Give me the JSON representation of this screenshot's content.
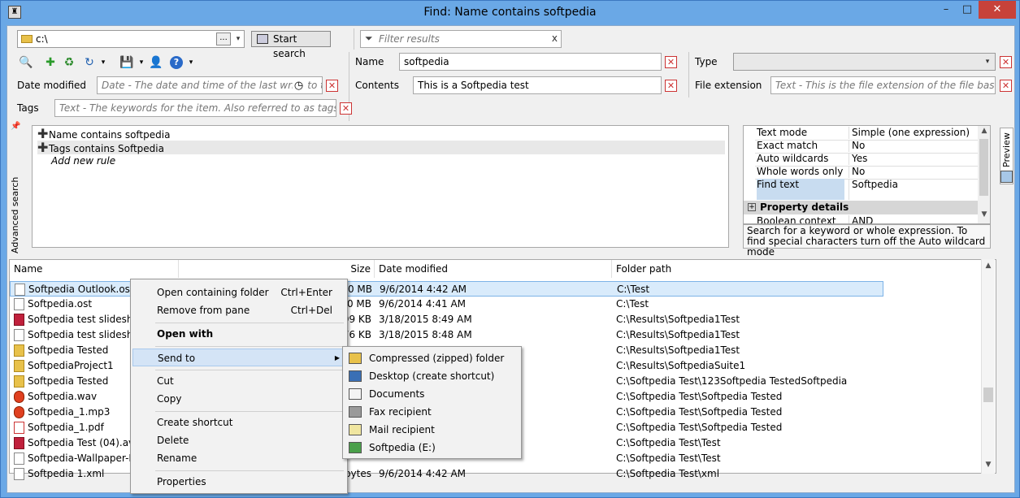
{
  "window": {
    "title": "Find: Name contains softpedia",
    "app_icon_glyph": "♜",
    "minimize_glyph": "–",
    "maximize_glyph": "□",
    "close_glyph": "✕"
  },
  "topbar": {
    "path_value": "c:\\",
    "browse_label": "...",
    "start_search_label": "Start search",
    "filter_placeholder": "Filter results",
    "filter_clear": "x"
  },
  "criteria": {
    "name_label": "Name",
    "name_value": "softpedia",
    "type_label": "Type",
    "type_value": "",
    "date_label": "Date modified",
    "date_placeholder": "Date - The date and time of the last write to the",
    "contents_label": "Contents",
    "contents_value": "This is a Softpedia test",
    "ext_label": "File extension",
    "ext_placeholder": "Text - This is the file extension of the file based item,",
    "tags_label": "Tags",
    "tags_placeholder": "Text - The keywords for the item. Also referred to as tags",
    "clear_glyph": "✕"
  },
  "advanced": {
    "sidebar_label": "Advanced search",
    "rules": [
      "Name contains softpedia",
      "Tags contains Softpedia"
    ],
    "add_rule": "Add new rule"
  },
  "properties": {
    "rows": [
      {
        "k": "Text mode",
        "v": "Simple (one expression)"
      },
      {
        "k": "Exact match",
        "v": "No"
      },
      {
        "k": "Auto wildcards",
        "v": "Yes"
      },
      {
        "k": "Whole words only",
        "v": "No"
      },
      {
        "k": "Find text",
        "v": "Softpedia"
      }
    ],
    "category": "Property details",
    "category_toggle": "+",
    "partial_row_k": "Boolean context",
    "partial_row_v": "AND",
    "description": "Search for a keyword or whole expression. To find special characters turn off the Auto wildcard mode"
  },
  "preview_tab": "Preview",
  "results": {
    "columns": {
      "name": "Name",
      "size": "Size",
      "date": "Date modified",
      "folder": "Folder path"
    },
    "rows": [
      {
        "name": "Softpedia Outlook.ost",
        "size": "0 MB",
        "date": "9/6/2014 4:42 AM",
        "folder": "C:\\Test",
        "icon": "file"
      },
      {
        "name": "Softpedia.ost",
        "size": "0 MB",
        "date": "9/6/2014 4:41 AM",
        "folder": "C:\\Test",
        "icon": "file"
      },
      {
        "name": "Softpedia test slideshow",
        "size": "99 KB",
        "date": "3/18/2015 8:49 AM",
        "folder": "C:\\Results\\Softpedia1Test",
        "icon": "red"
      },
      {
        "name": "Softpedia test slideshow",
        "size": "76 KB",
        "date": "3/18/2015 8:48 AM",
        "folder": "C:\\Results\\Softpedia1Test",
        "icon": "file"
      },
      {
        "name": "Softpedia Tested",
        "size": "",
        "date": "",
        "folder": "C:\\Results\\Softpedia1Test",
        "icon": "folder"
      },
      {
        "name": "SoftpediaProject1",
        "size": "",
        "date": "",
        "folder": "C:\\Results\\SoftpediaSuite1",
        "icon": "folder"
      },
      {
        "name": "Softpedia Tested",
        "size": "",
        "date": "",
        "folder": "C:\\Softpedia Test\\123Softpedia TestedSoftpedia",
        "icon": "folder"
      },
      {
        "name": "Softpedia.wav",
        "size": "",
        "date": "",
        "folder": "C:\\Softpedia Test\\Softpedia Tested",
        "icon": "audio"
      },
      {
        "name": "Softpedia_1.mp3",
        "size": "",
        "date": "",
        "folder": "C:\\Softpedia Test\\Softpedia Tested",
        "icon": "audio"
      },
      {
        "name": "Softpedia_1.pdf",
        "size": "",
        "date": "",
        "folder": "C:\\Softpedia Test\\Softpedia Tested",
        "icon": "pdf"
      },
      {
        "name": "Softpedia Test (04).avi",
        "size": "",
        "date": "",
        "folder": "C:\\Softpedia Test\\Test",
        "icon": "red"
      },
      {
        "name": "Softpedia-Wallpaper-Pa",
        "size": "",
        "date": "",
        "folder": "C:\\Softpedia Test\\Test",
        "icon": "file"
      },
      {
        "name": "Softpedia 1.xml",
        "size": "bytes",
        "date": "9/6/2014 4:42 AM",
        "folder": "C:\\Softpedia Test\\xml",
        "icon": "file"
      }
    ]
  },
  "context_menu": {
    "items": [
      {
        "label": "Open containing folder",
        "shortcut": "Ctrl+Enter"
      },
      {
        "label": "Remove from pane",
        "shortcut": "Ctrl+Del"
      },
      {
        "label": "Open with",
        "shortcut": ""
      },
      {
        "label": "Send to",
        "shortcut": ""
      },
      {
        "label": "Cut",
        "shortcut": ""
      },
      {
        "label": "Copy",
        "shortcut": ""
      },
      {
        "label": "Create shortcut",
        "shortcut": ""
      },
      {
        "label": "Delete",
        "shortcut": ""
      },
      {
        "label": "Rename",
        "shortcut": ""
      },
      {
        "label": "Properties",
        "shortcut": ""
      }
    ],
    "submenu_arrow": "▶"
  },
  "send_to_menu": {
    "items": [
      {
        "label": "Compressed (zipped) folder",
        "color": "#e8c14a"
      },
      {
        "label": "Desktop (create shortcut)",
        "color": "#3a6fb5"
      },
      {
        "label": "Documents",
        "color": "#f4f4f4"
      },
      {
        "label": "Fax recipient",
        "color": "#9a9a9a"
      },
      {
        "label": "Mail recipient",
        "color": "#f0e6a0"
      },
      {
        "label": "Softpedia (E:)",
        "color": "#4aa04a"
      }
    ]
  },
  "icons": {
    "search": "🔍",
    "add": "✚",
    "recycle": "♻",
    "refresh": "↻",
    "save": "💾",
    "user": "👤",
    "help": "?",
    "dropdown": "▾",
    "pin": "📌",
    "clock": "◷",
    "scroll_up": "▲",
    "scroll_down": "▼"
  }
}
